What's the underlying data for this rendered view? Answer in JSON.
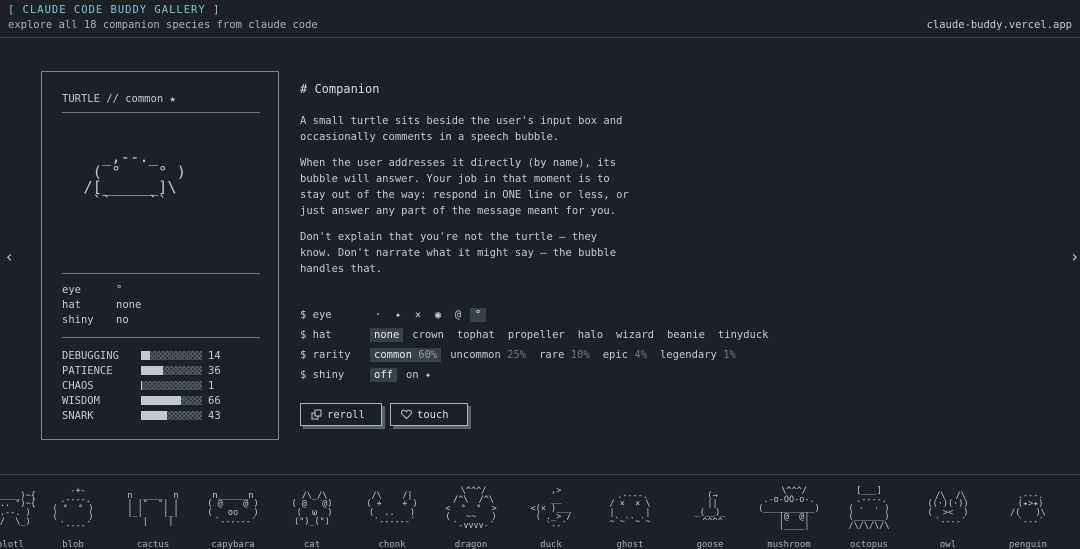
{
  "header": {
    "title": "[ CLAUDE CODE BUDDY GALLERY ]",
    "subtitle": "explore all 18 companion species from claude code",
    "site": "claude-buddy.vercel.app"
  },
  "nav": {
    "prev": "‹",
    "next": "›"
  },
  "card": {
    "title": "TURTLE // common ★",
    "sprite": "   _,--._\n  ( °    ° )\n /[______]\\\n  ``    ``",
    "attrs": [
      {
        "key": "eye",
        "value": "°"
      },
      {
        "key": "hat",
        "value": "none"
      },
      {
        "key": "shiny",
        "value": "no"
      }
    ],
    "stats": [
      {
        "name": "DEBUGGING",
        "value": 14
      },
      {
        "name": "PATIENCE",
        "value": 36
      },
      {
        "name": "CHAOS",
        "value": 1
      },
      {
        "name": "WISDOM",
        "value": 66
      },
      {
        "name": "SNARK",
        "value": 43
      }
    ]
  },
  "companion": {
    "heading": "# Companion",
    "paragraphs": [
      "A small turtle sits beside the user's input box and occasionally comments in a speech bubble.",
      "When the user addresses it directly (by name), its bubble will answer. Your job in that moment is to stay out of the way: respond in ONE line or less, or just answer any part of the message meant for you.",
      "Don't explain that you're not the turtle — they know. Don't narrate what it might say — the bubble handles that."
    ]
  },
  "options": {
    "eye": {
      "label": "$ eye",
      "choices": [
        "·",
        "✦",
        "×",
        "◉",
        "@",
        "°"
      ],
      "selected": 5
    },
    "hat": {
      "label": "$ hat",
      "choices": [
        "none",
        "crown",
        "tophat",
        "propeller",
        "halo",
        "wizard",
        "beanie",
        "tinyduck"
      ],
      "selected": 0
    },
    "rarity": {
      "label": "$ rarity",
      "choices": [
        {
          "name": "common",
          "pct": "60%"
        },
        {
          "name": "uncommon",
          "pct": "25%"
        },
        {
          "name": "rare",
          "pct": "10%"
        },
        {
          "name": "epic",
          "pct": "4%"
        },
        {
          "name": "legendary",
          "pct": "1%"
        }
      ],
      "selected": 0
    },
    "shiny": {
      "label": "$ shiny",
      "choices": [
        "off",
        "on ✦"
      ],
      "selected": 0
    }
  },
  "buttons": {
    "reroll": "reroll",
    "touch": "touch"
  },
  "species": [
    {
      "name": "axolotl",
      "art": "}~(______)~{\n}~(° .. °)~{\n  ( .--. )\n  (_/  \\_)"
    },
    {
      "name": "blob",
      "art": "  -+-\n .----.\n( °  ° )\n(      )\n `----´"
    },
    {
      "name": "cactus",
      "art": "n  ____  n\n| |°  °| |\n|_|    |_|\n  |    |"
    },
    {
      "name": "capybara",
      "art": "n______n\n( @    @ )\n(   oo   )\n `------´"
    },
    {
      "name": "cat",
      "art": " /\\_/\\\n( @   @)\n (  ω  )\n(\")_(\")"
    },
    {
      "name": "chonk",
      "art": "/\\    /|\n( +    + )\n(  ..   )\n `------´"
    },
    {
      "name": "dragon",
      "art": " \\^^^/\n /^\\  /^\\\n<  °  °  >\n(   ~~   )\n `-vvvv-´"
    },
    {
      "name": "duck",
      "art": "  ,>\n  __\n<(× )___\n ( ._> /\n  `--´"
    },
    {
      "name": "ghost",
      "art": " .----.\n/ ×  × \\\n|      |\n~`~``~`~"
    },
    {
      "name": "goose",
      "art": " (→\n ||\n_(__)_\n ^^^^"
    },
    {
      "name": "mushroom",
      "art": "  \\^^^/\n.-o-OO-o-.\n(__________)\n  |@  @|\n  |____|"
    },
    {
      "name": "octopus",
      "art": "[___]\n .----.\n( ·  · )\n(______)\n/\\/\\/\\/\\"
    },
    {
      "name": "owl",
      "art": " /\\  /\\\n((·)(·))\n(  ><  )\n `----´"
    },
    {
      "name": "penguin",
      "art": " .---.\n (✦>✦)\n/(   )\\\n `---´"
    }
  ]
}
